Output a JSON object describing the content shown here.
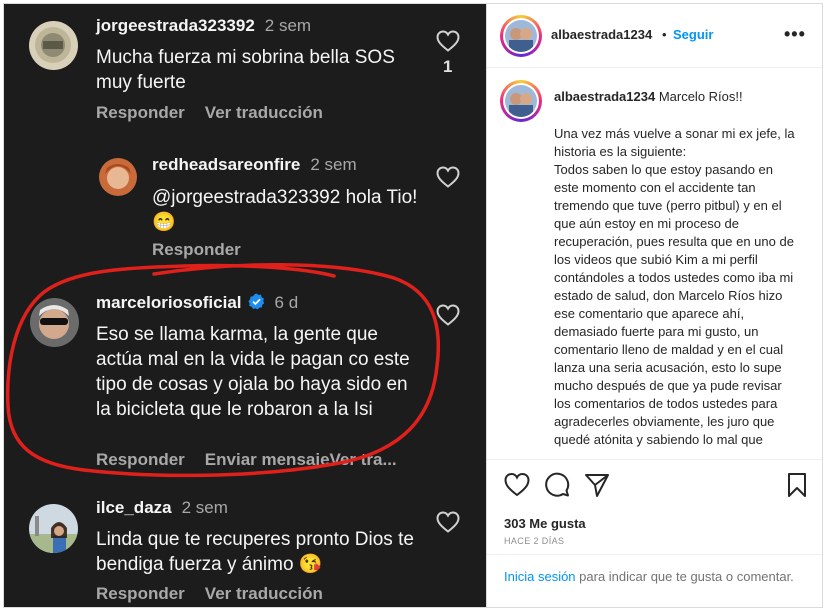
{
  "comments": [
    {
      "username": "jorgeestrada323392",
      "time": "2 sem",
      "text": "Mucha fuerza mi sobrina bella SOS muy fuerte",
      "reply_label": "Responder",
      "translate_label": "Ver traducción",
      "like_count": "1"
    },
    {
      "username": "redheadsareonfire",
      "time": "2 sem",
      "text": "@jorgeestrada323392 hola Tio!😁",
      "reply_label": "Responder"
    },
    {
      "username": "marceloriosoficial",
      "time": "6 d",
      "text": "Eso se llama karma, la gente que actúa mal en la vida le pagan co este tipo de cosas y ojala bo haya sido en la bicicleta que le robaron a la Isi",
      "reply_label": "Responder",
      "message_label": "Enviar mensaje",
      "translate_label": "Ver tra...",
      "verified": true
    },
    {
      "username": "ilce_daza",
      "time": "2 sem",
      "text": "Linda que te recuperes pronto Dios te bendiga fuerza y ánimo 😘",
      "reply_label": "Responder",
      "translate_label": "Ver traducción"
    }
  ],
  "post": {
    "username": "albaestrada1234",
    "dot": "•",
    "follow_label": "Seguir",
    "more_label": "•••",
    "caption_title": "Marcelo Ríos!!",
    "caption_body": "Una vez más vuelve a sonar mi ex jefe, la historia es la siguiente:\nTodos saben lo que estoy pasando en este momento con el accidente tan tremendo que tuve (perro pitbul) y en el que aún estoy en mi proceso de recuperación, pues resulta que en uno de los videos que subió Kim a mi perfil contándoles a todos ustedes como iba mi estado de salud, don Marcelo Ríos hizo ese comentario que aparece ahí, demasiado fuerte para mi gusto, un comentario lleno de maldad y en el cual lanza una seria acusación, esto lo supe mucho después de que ya pude revisar los comentarios de todos ustedes para agradecerles obviamente, les juro que quedé atónita y sabiendo lo mal que",
    "likes": "303 Me gusta",
    "ago": "HACE 2 DÍAS",
    "login_link": "Inicia sesión",
    "login_rest": " para indicar que te gusta o comentar."
  },
  "icons": {
    "heart": "heart-icon",
    "comment": "comment-bubble-icon",
    "share": "share-plane-icon",
    "save": "bookmark-icon",
    "verified": "verified-badge-icon"
  },
  "colors": {
    "accent": "#0095f6",
    "dark_bg": "#1c1c1c",
    "annotation_red": "#e0201b"
  }
}
